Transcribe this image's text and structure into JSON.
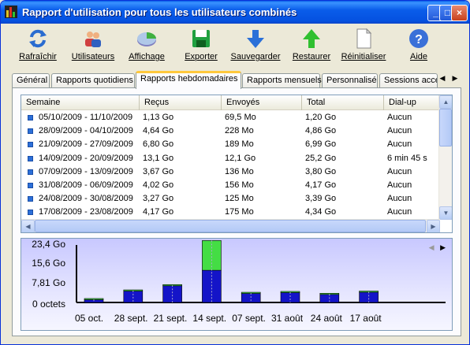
{
  "window": {
    "title": "Rapport d'utilisation pour tous les utilisateurs combinés"
  },
  "toolbar": {
    "buttons": [
      {
        "label": "Rafraîchir",
        "icon": "refresh-icon"
      },
      {
        "label": "Utilisateurs",
        "icon": "users-icon"
      },
      {
        "label": "Affichage",
        "icon": "view-icon"
      },
      {
        "label": "Exporter",
        "icon": "save-disk-icon"
      },
      {
        "label": "Sauvegarder",
        "icon": "down-arrow-icon"
      },
      {
        "label": "Restaurer",
        "icon": "up-arrow-icon"
      },
      {
        "label": "Réinitialiser",
        "icon": "blank-page-icon"
      },
      {
        "label": "Aide",
        "icon": "help-icon"
      }
    ]
  },
  "tabs": [
    {
      "label": "Général"
    },
    {
      "label": "Rapports quotidiens"
    },
    {
      "label": "Rapports hebdomadaires",
      "active": true
    },
    {
      "label": "Rapports mensuels"
    },
    {
      "label": "Personnalisé"
    },
    {
      "label": "Sessions acce"
    }
  ],
  "table": {
    "columns": [
      "Semaine",
      "Reçus",
      "Envoyés",
      "Total",
      "Dial-up"
    ],
    "rows": [
      [
        "05/10/2009 - 11/10/2009",
        "1,13 Go",
        "69,5 Mo",
        "1,20 Go",
        "Aucun"
      ],
      [
        "28/09/2009 - 04/10/2009",
        "4,64 Go",
        "228 Mo",
        "4,86 Go",
        "Aucun"
      ],
      [
        "21/09/2009 - 27/09/2009",
        "6,80 Go",
        "189 Mo",
        "6,99 Go",
        "Aucun"
      ],
      [
        "14/09/2009 - 20/09/2009",
        "13,1 Go",
        "12,1 Go",
        "25,2 Go",
        "6 min 45 s"
      ],
      [
        "07/09/2009 - 13/09/2009",
        "3,67 Go",
        "136 Mo",
        "3,80 Go",
        "Aucun"
      ],
      [
        "31/08/2009 - 06/09/2009",
        "4,02 Go",
        "156 Mo",
        "4,17 Go",
        "Aucun"
      ],
      [
        "24/08/2009 - 30/08/2009",
        "3,27 Go",
        "125 Mo",
        "3,39 Go",
        "Aucun"
      ],
      [
        "17/08/2009 - 23/08/2009",
        "4,17 Go",
        "175 Mo",
        "4,34 Go",
        "Aucun"
      ]
    ]
  },
  "chart_data": {
    "type": "bar",
    "stacked": true,
    "categories": [
      "05 oct.",
      "28 sept.",
      "21 sept.",
      "14 sept.",
      "07 sept.",
      "31 août",
      "24 août",
      "17 août"
    ],
    "series": [
      {
        "values": [
          1.13,
          4.64,
          6.8,
          13.1,
          3.67,
          4.02,
          3.27,
          4.17
        ],
        "color": "#1414c8"
      },
      {
        "values": [
          0.07,
          0.22,
          0.19,
          12.1,
          0.14,
          0.16,
          0.13,
          0.18
        ],
        "color": "#44dd44"
      }
    ],
    "y_ticks": [
      "23,4 Go",
      "15,6 Go",
      "7,81 Go",
      "0 octets"
    ],
    "ylim": [
      0,
      23.4
    ]
  },
  "chart_nav": {
    "prev": "◀",
    "next": "▶"
  },
  "scroll": {
    "up": "▲",
    "down": "▼",
    "left": "◀",
    "right": "▶"
  },
  "tab_nav": {
    "prev": "◀",
    "next": "▶"
  },
  "title_buttons": {
    "minimize": "_",
    "maximize": "□",
    "close": "×"
  }
}
